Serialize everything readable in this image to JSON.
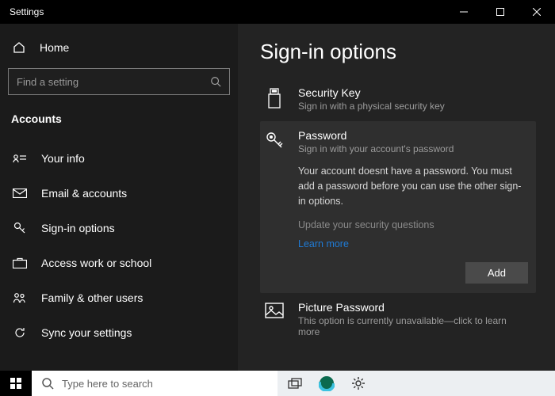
{
  "window": {
    "title": "Settings"
  },
  "sidebar": {
    "home": "Home",
    "search_placeholder": "Find a setting",
    "category": "Accounts",
    "items": [
      {
        "label": "Your info"
      },
      {
        "label": "Email & accounts"
      },
      {
        "label": "Sign-in options"
      },
      {
        "label": "Access work or school"
      },
      {
        "label": "Family & other users"
      },
      {
        "label": "Sync your settings"
      }
    ]
  },
  "main": {
    "heading": "Sign-in options",
    "security_key": {
      "title": "Security Key",
      "sub": "Sign in with a physical security key"
    },
    "password": {
      "title": "Password",
      "sub": "Sign in with your account's password",
      "body": "Your account doesnt have a password. You must add a password before you can use the other sign-in options.",
      "update": "Update your security questions",
      "learn": "Learn more",
      "add": "Add"
    },
    "picture": {
      "title": "Picture Password",
      "sub": "This option is currently unavailable—click to learn more"
    }
  },
  "taskbar": {
    "search_placeholder": "Type here to search"
  }
}
